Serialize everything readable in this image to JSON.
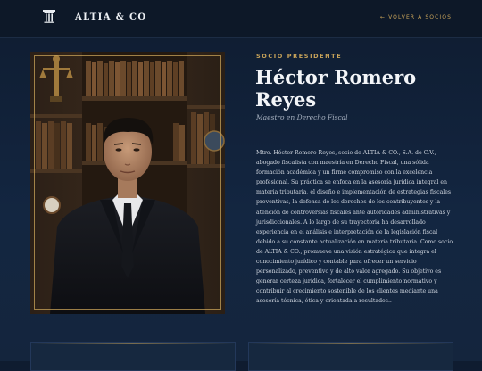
{
  "header": {
    "brand": "ALTIA & CO",
    "back_link": "← VOLVER A SOCIOS",
    "logo_icon": "pillar-icon"
  },
  "profile": {
    "eyebrow": "SOCIO PRESIDENTE",
    "name_line1": "Héctor Romero",
    "name_line2": "Reyes",
    "role": "Maestro en Derecho Fiscal",
    "bio": "Mtro. Héctor Romero Reyes, socio de ALTIA & CO., S.A. de C.V., abogado fiscalista con maestría en Derecho Fiscal, una sólida formación académica y un firme compromiso con la excelencia profesional. Su práctica se enfoca en la asesoría jurídica integral en materia tributaria, el diseño e implementación de estrategias fiscales preventivas, la defensa de los derechos de los contribuyentes y la atención de controversias fiscales ante autoridades administrativas y jurisdiccionales. A lo largo de su trayectoria ha desarrollado experiencia en el análisis e interpretación de la legislación fiscal debido a su constante actualización en materia tributaria. Como socio de ALTIA & CO., promueve una visión estratégica que integra el conocimiento jurídico y contable para ofrecer un servicio personalizado, preventivo y de alto valor agregado. Su objetivo es generar certeza jurídica, fortalecer el cumplimiento normativo y contribuir al crecimiento sostenible de los clientes mediante una asesoría técnica, ética y orientada a resultados..",
    "photo_alt": "Héctor Romero Reyes"
  },
  "colors": {
    "accent_gold": "#c9a45a",
    "background_navy": "#132641",
    "header_navy": "#0d1828"
  }
}
